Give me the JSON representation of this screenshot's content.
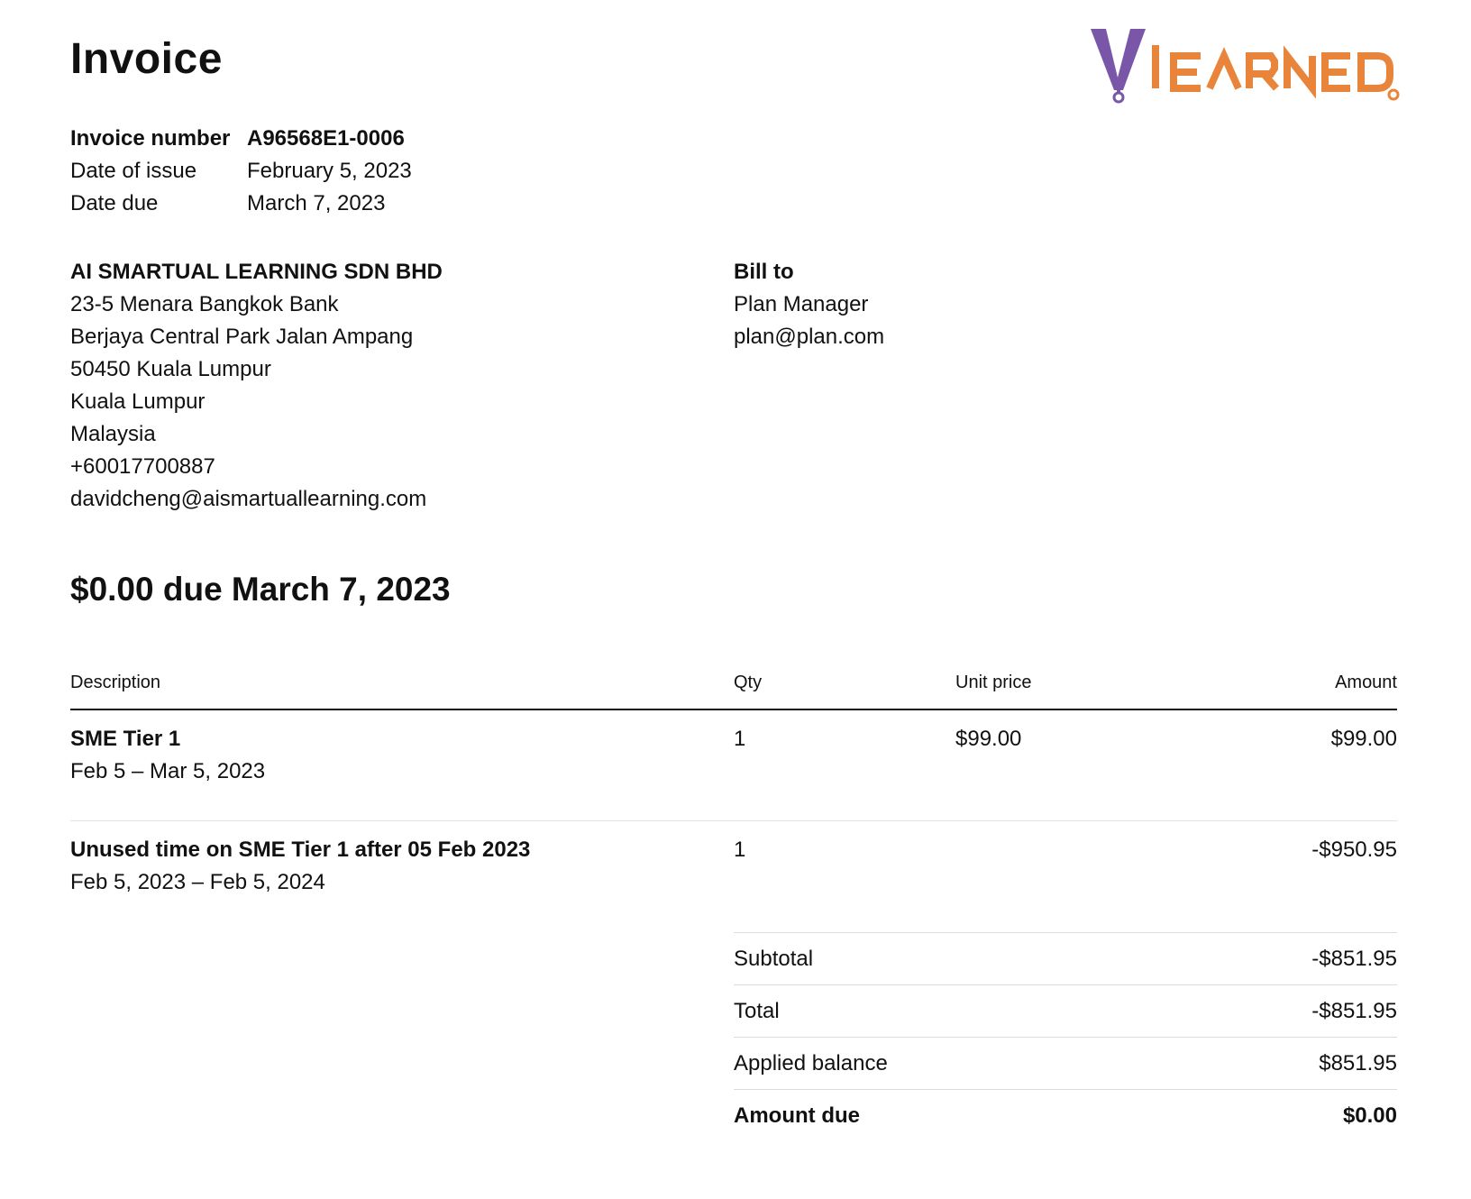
{
  "header": {
    "title": "Invoice",
    "logo_text": "VLEARNED",
    "logo_colors": {
      "purple": "#7a56a9",
      "orange": "#e8853b"
    }
  },
  "meta": {
    "rows": [
      {
        "label": "Invoice number",
        "value": "A96568E1-0006"
      },
      {
        "label": "Date of issue",
        "value": "February 5, 2023"
      },
      {
        "label": "Date due",
        "value": "March 7, 2023"
      }
    ]
  },
  "seller": {
    "name": "AI SMARTUAL LEARNING SDN BHD",
    "lines": [
      "23-5 Menara Bangkok Bank",
      "Berjaya Central Park Jalan Ampang",
      "50450 Kuala Lumpur",
      "Kuala Lumpur",
      "Malaysia",
      "+60017700887",
      "davidcheng@aismartuallearning.com"
    ]
  },
  "bill_to": {
    "heading": "Bill to",
    "name": "Plan Manager",
    "email": "plan@plan.com"
  },
  "due_headline": "$0.00 due March 7, 2023",
  "items": {
    "headers": {
      "description": "Description",
      "qty": "Qty",
      "unit_price": "Unit price",
      "amount": "Amount"
    },
    "rows": [
      {
        "title": "SME Tier 1",
        "period": "Feb 5 – Mar 5, 2023",
        "qty": "1",
        "unit_price": "$99.00",
        "amount": "$99.00"
      },
      {
        "title": "Unused time on SME Tier 1 after 05 Feb 2023",
        "period": "Feb 5, 2023 – Feb 5, 2024",
        "qty": "1",
        "unit_price": "",
        "amount": "-$950.95"
      }
    ]
  },
  "totals": [
    {
      "label": "Subtotal",
      "value": "-$851.95"
    },
    {
      "label": "Total",
      "value": "-$851.95"
    },
    {
      "label": "Applied balance",
      "value": "$851.95"
    },
    {
      "label": "Amount due",
      "value": "$0.00"
    }
  ]
}
